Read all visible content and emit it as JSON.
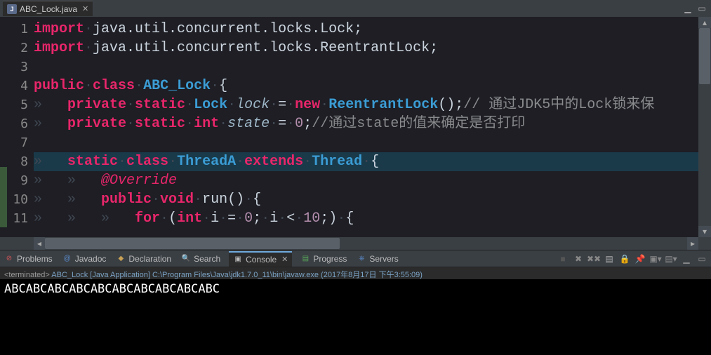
{
  "editor_tab": {
    "filename": "ABC_Lock.java"
  },
  "code_lines": {
    "l1": {
      "import": "import",
      "path": "java.util.concurrent.locks.Lock"
    },
    "l2": {
      "import": "import",
      "path": "java.util.concurrent.locks.ReentrantLock"
    },
    "l4": {
      "public": "public",
      "class": "class",
      "name": "ABC_Lock"
    },
    "l5": {
      "private": "private",
      "static": "static",
      "type": "Lock",
      "var": "lock",
      "new": "new",
      "ctor": "ReentrantLock",
      "comment": "// 通过JDK5中的Lock锁来保"
    },
    "l6": {
      "private": "private",
      "static": "static",
      "type": "int",
      "var": "state",
      "val": "0",
      "comment": "//通过state的值来确定是否打印"
    },
    "l8": {
      "static": "static",
      "class": "class",
      "name": "ThreadA",
      "extends": "extends",
      "super": "Thread"
    },
    "l9": {
      "ann": "@Override"
    },
    "l10": {
      "public": "public",
      "void": "void",
      "name": "run"
    },
    "l11": {
      "for": "for",
      "int": "int",
      "var": "i",
      "init": "0",
      "cmp": "i",
      "lt": "<",
      "limit": "10"
    }
  },
  "bottom_tabs": {
    "problems": "Problems",
    "javadoc": "Javadoc",
    "declaration": "Declaration",
    "search": "Search",
    "console": "Console",
    "progress": "Progress",
    "servers": "Servers"
  },
  "terminated": {
    "prefix": "<terminated>",
    "rest": " ABC_Lock [Java Application] C:\\Program Files\\Java\\jdk1.7.0_11\\bin\\javaw.exe (2017年8月17日 下午3:55:09)"
  },
  "console_output": "ABCABCABCABCABCABCABCABCABCABC"
}
